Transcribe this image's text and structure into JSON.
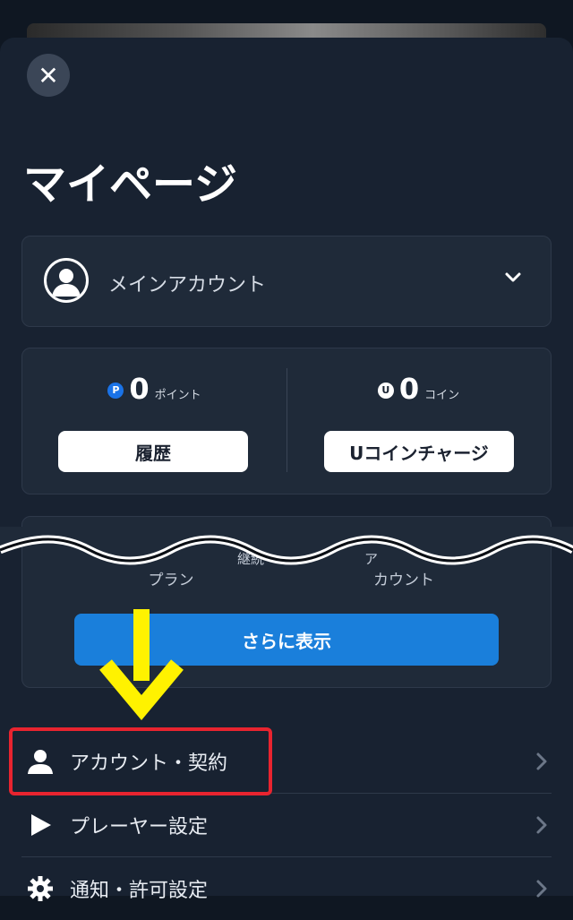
{
  "page": {
    "title": "マイページ"
  },
  "account": {
    "name": "メインアカウント"
  },
  "points": {
    "point_badge": "P",
    "point_value": "0",
    "point_unit": "ポイント",
    "history_label": "履歴",
    "coin_badge": "U",
    "coin_value": "0",
    "coin_unit": "コイン",
    "charge_label": "Uコインチャージ"
  },
  "lower_card": {
    "partial_labels": [
      "プラン",
      "カウント"
    ],
    "partial_top_labels": [
      "継続",
      "ア"
    ],
    "show_more_label": "さらに表示"
  },
  "menu": {
    "items": [
      {
        "label": "アカウント・契約",
        "icon": "person-icon",
        "highlighted": true
      },
      {
        "label": "プレーヤー設定",
        "icon": "play-icon",
        "highlighted": false
      },
      {
        "label": "通知・許可設定",
        "icon": "gear-icon",
        "highlighted": false
      }
    ]
  },
  "colors": {
    "background": "#182231",
    "card": "#1f2a39",
    "accent_blue": "#1a7fdb",
    "highlight_red": "#e8242f",
    "arrow_yellow": "#fff200"
  }
}
